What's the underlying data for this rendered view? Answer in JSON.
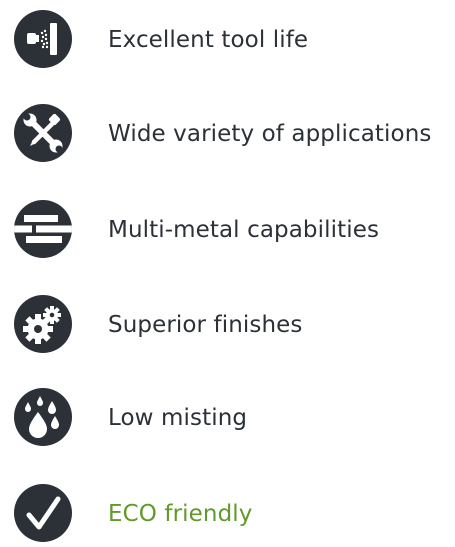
{
  "features": [
    {
      "label": "Excellent tool life",
      "icon": "spray-tool-icon",
      "color": "#2c3138"
    },
    {
      "label": "Wide variety of applications",
      "icon": "wrench-screwdriver-icon",
      "color": "#2c3138"
    },
    {
      "label": "Multi-metal capabilities",
      "icon": "metal-bars-icon",
      "color": "#2c3138"
    },
    {
      "label": "Superior finishes",
      "icon": "gears-icon",
      "color": "#2c3138"
    },
    {
      "label": "Low misting",
      "icon": "droplets-icon",
      "color": "#2c3138"
    },
    {
      "label": "ECO friendly",
      "icon": "checkmark-icon",
      "color": "#5f9a2a"
    }
  ],
  "colors": {
    "icon_background": "#2c3138",
    "text": "#2c3138",
    "eco_accent": "#5f9a2a",
    "page_background": "#ffffff"
  }
}
